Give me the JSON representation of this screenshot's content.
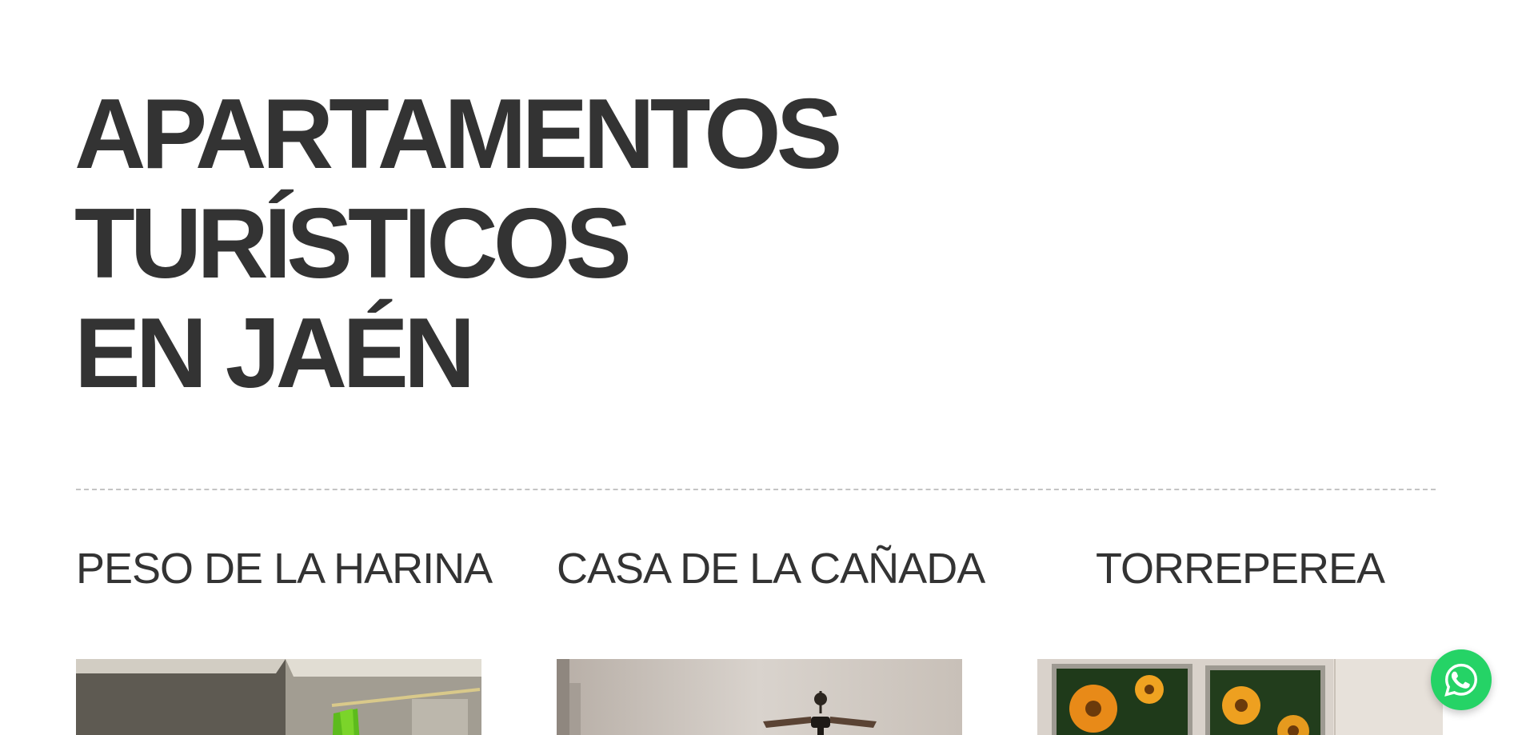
{
  "hero": {
    "title_lines": [
      "APARTAMENTOS",
      "TURÍSTICOS",
      "EN JAÉN"
    ]
  },
  "apartments": [
    {
      "title": "PESO DE LA HARINA",
      "image_icon": "bedroom-photo"
    },
    {
      "title": "CASA DE LA CAÑADA",
      "image_icon": "living-room-ceiling-fan-photo"
    },
    {
      "title": "TORREPEREA",
      "image_icon": "sunflower-paintings-photo"
    }
  ],
  "whatsapp": {
    "icon": "whatsapp-icon",
    "color": "#25d366"
  },
  "colors": {
    "text": "#333333",
    "divider": "#c4c4c4",
    "background": "#ffffff"
  }
}
